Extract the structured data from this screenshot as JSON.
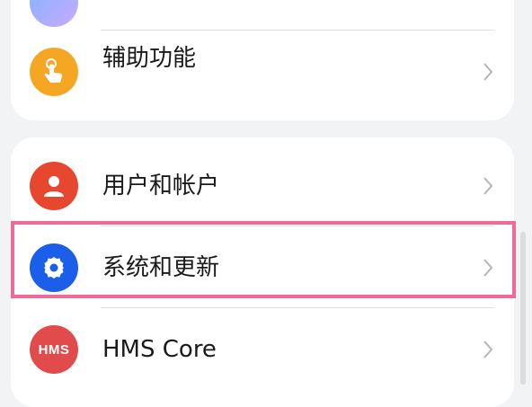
{
  "settings": {
    "items": [
      {
        "label": "辅助功能"
      },
      {
        "label": "用户和帐户"
      },
      {
        "label": "系统和更新"
      },
      {
        "label": "HMS Core"
      }
    ],
    "hms_icon_text": "HMS"
  },
  "colors": {
    "background": "#f1f3f5",
    "accessibility_icon": "#f5a623",
    "users_icon": "#e8472f",
    "system_icon": "#1a5eea",
    "hms_icon": "#e24b4b",
    "highlight_border": "#f06a98"
  },
  "icons": {
    "accessibility": "hand-tap-icon",
    "users": "person-icon",
    "system": "gear-icon",
    "hms": "hms-logo-icon",
    "chevron": "chevron-right-icon"
  }
}
